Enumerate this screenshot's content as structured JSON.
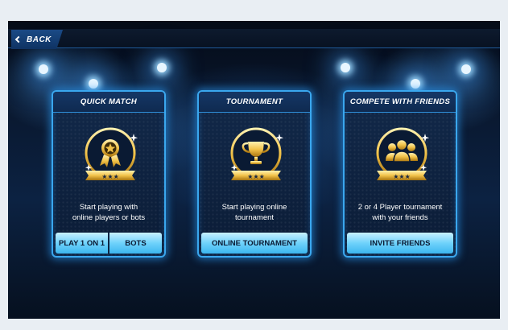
{
  "header": {
    "back_label": "BACK"
  },
  "colors": {
    "accent_blue": "#3aa7ee",
    "button_blue": "#6fd2fb",
    "gold": "#f2c34a",
    "background": "#0a1a33"
  },
  "cards": [
    {
      "title": "QUICK MATCH",
      "emblem_icon": "medal-star-icon",
      "description": "Start playing with\nonline players or bots",
      "buttons": [
        "PLAY 1 ON 1",
        "BOTS"
      ]
    },
    {
      "title": "TOURNAMENT",
      "emblem_icon": "trophy-icon",
      "description": "Start playing online\ntournament",
      "buttons": [
        "ONLINE TOURNAMENT"
      ]
    },
    {
      "title": "COMPETE WITH FRIENDS",
      "emblem_icon": "group-of-friends-icon",
      "description": "2 or 4 Player tournament\nwith your friends",
      "buttons": [
        "INVITE FRIENDS"
      ]
    }
  ]
}
